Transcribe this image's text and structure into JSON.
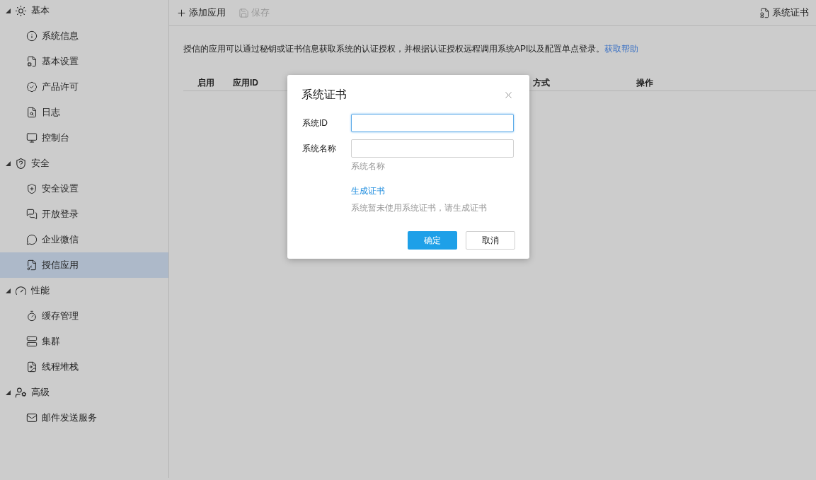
{
  "sidebar": {
    "groups": [
      {
        "label": "基本",
        "expanded": true,
        "children": [
          {
            "label": "系统信息",
            "selected": false
          },
          {
            "label": "基本设置",
            "selected": false
          },
          {
            "label": "产品许可",
            "selected": false
          },
          {
            "label": "日志",
            "selected": false
          },
          {
            "label": "控制台",
            "selected": false
          }
        ]
      },
      {
        "label": "安全",
        "expanded": true,
        "children": [
          {
            "label": "安全设置",
            "selected": false
          },
          {
            "label": "开放登录",
            "selected": false
          },
          {
            "label": "企业微信",
            "selected": false
          },
          {
            "label": "授信应用",
            "selected": true
          }
        ]
      },
      {
        "label": "性能",
        "expanded": true,
        "children": [
          {
            "label": "缓存管理",
            "selected": false
          },
          {
            "label": "集群",
            "selected": false
          },
          {
            "label": "线程堆栈",
            "selected": false
          }
        ]
      },
      {
        "label": "高级",
        "expanded": true,
        "children": [
          {
            "label": "邮件发送服务",
            "selected": false
          }
        ]
      }
    ]
  },
  "toolbar": {
    "buttons": [
      {
        "label": "添加应用",
        "disabled": false
      },
      {
        "label": "保存",
        "disabled": true
      }
    ],
    "right_button": {
      "label": "系统证书"
    }
  },
  "description": {
    "text": "授信的应用可以通过秘钥或证书信息获取系统的认证授权，并根据认证授权远程调用系统API以及配置单点登录。",
    "link": "获取帮助"
  },
  "table": {
    "columns": [
      "启用",
      "应用ID",
      "方式",
      "操作"
    ]
  },
  "dialog": {
    "title": "系统证书",
    "fields": [
      {
        "label": "系统ID",
        "focused": true
      },
      {
        "label": "系统名称",
        "focused": false,
        "hint": "系统名称"
      }
    ],
    "link": "生成证书",
    "note": "系统暂未使用系统证书，请生成证书",
    "buttons": [
      {
        "label": "确定",
        "primary": true
      },
      {
        "label": "取消",
        "primary": false
      }
    ]
  }
}
